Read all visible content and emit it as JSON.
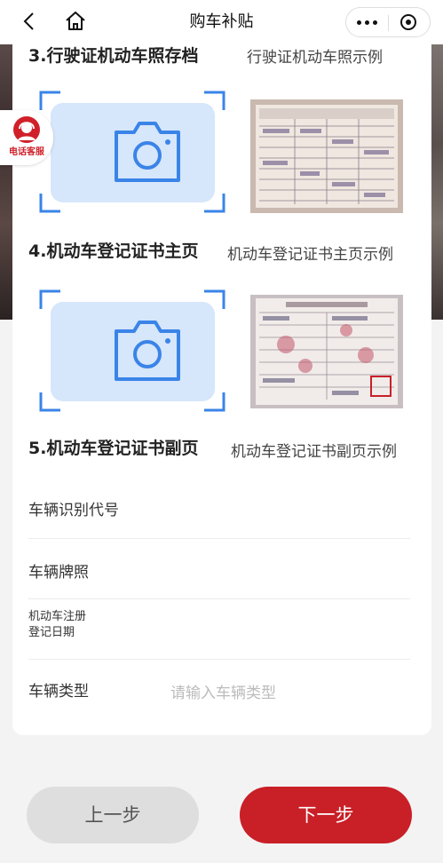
{
  "nav": {
    "title": "购车补贴"
  },
  "support": {
    "label": "电话客服"
  },
  "sections": [
    {
      "title": "3.行驶证机动车照存档",
      "sample_label": "行驶证机动车照示例"
    },
    {
      "title": "4.机动车登记证书主页",
      "sample_label": "机动车登记证书主页示例"
    },
    {
      "title": "5.机动车登记证书副页",
      "sample_label": "机动车登记证书副页示例"
    }
  ],
  "form": {
    "vin_label": "车辆识别代号",
    "plate_label": "车辆牌照",
    "register_date_label_line1": "机动车注册",
    "register_date_label_line2": "登记日期",
    "type_label": "车辆类型",
    "type_placeholder": "请输入车辆类型"
  },
  "buttons": {
    "prev": "上一步",
    "next": "下一步"
  },
  "colors": {
    "brand_red": "#c91f27",
    "upload_blue": "#3a84e8",
    "upload_bg": "#d6e6fb"
  }
}
